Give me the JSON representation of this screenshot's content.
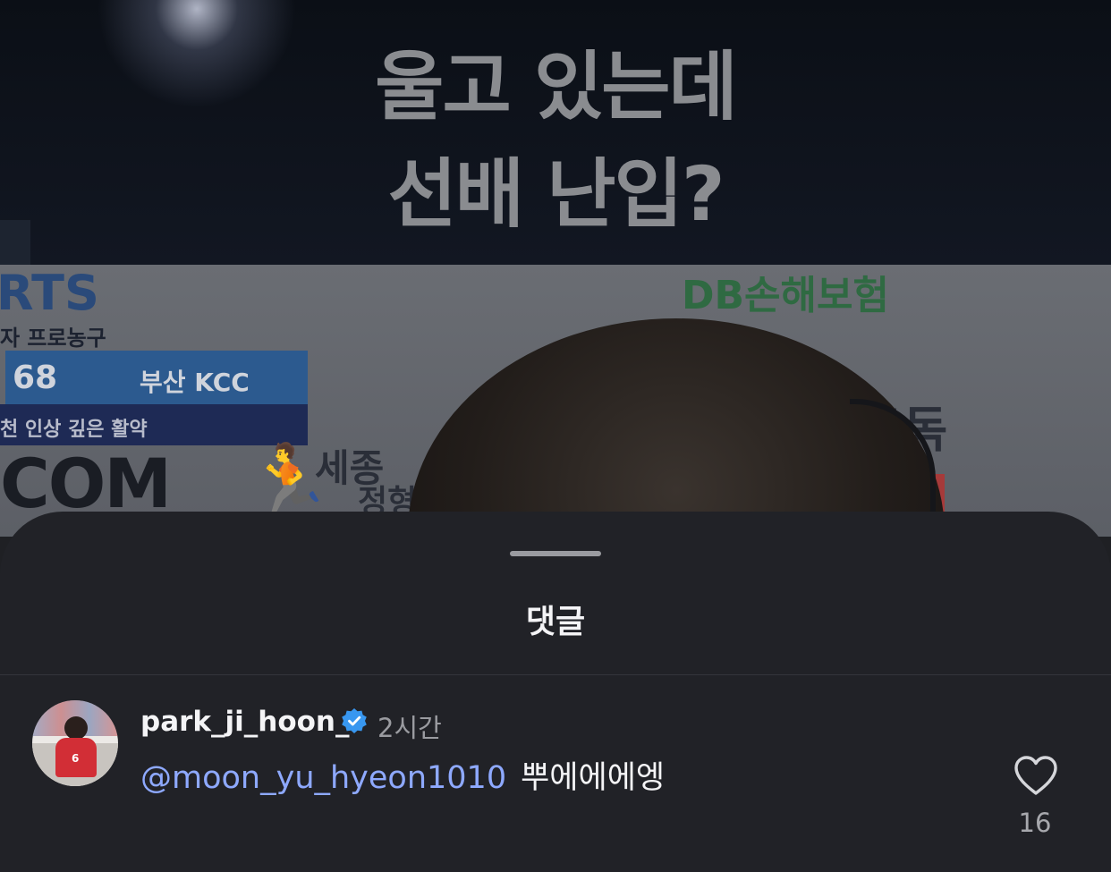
{
  "video": {
    "caption_line1": "울고 있는데",
    "caption_line2": "선배 난입?",
    "background_text": {
      "brand_left": "RTS",
      "brand_sub": "자 프로농구",
      "score": "68",
      "team": "부산 KCC",
      "strip": "천 인상 깊은 활약",
      "brand_com": "COM",
      "sponsor_top": "DB손해보험",
      "sejong": "세종",
      "sejong2": "정형",
      "sponsor_right": "구독"
    }
  },
  "sheet": {
    "title": "댓글"
  },
  "comment": {
    "username": "park_ji_hoon_",
    "verified": true,
    "time": "2시간",
    "mention": "@moon_yu_hyeon1010",
    "text": "뿌에에에엥",
    "likes": "16",
    "avatar_jersey_number": "6"
  },
  "colors": {
    "sheet_bg": "#212227",
    "mention": "#8ea9ff",
    "verified_badge": "#3897f0",
    "muted_text": "#9a9ba0"
  },
  "icons": [
    "verified-badge-icon",
    "heart-icon"
  ]
}
